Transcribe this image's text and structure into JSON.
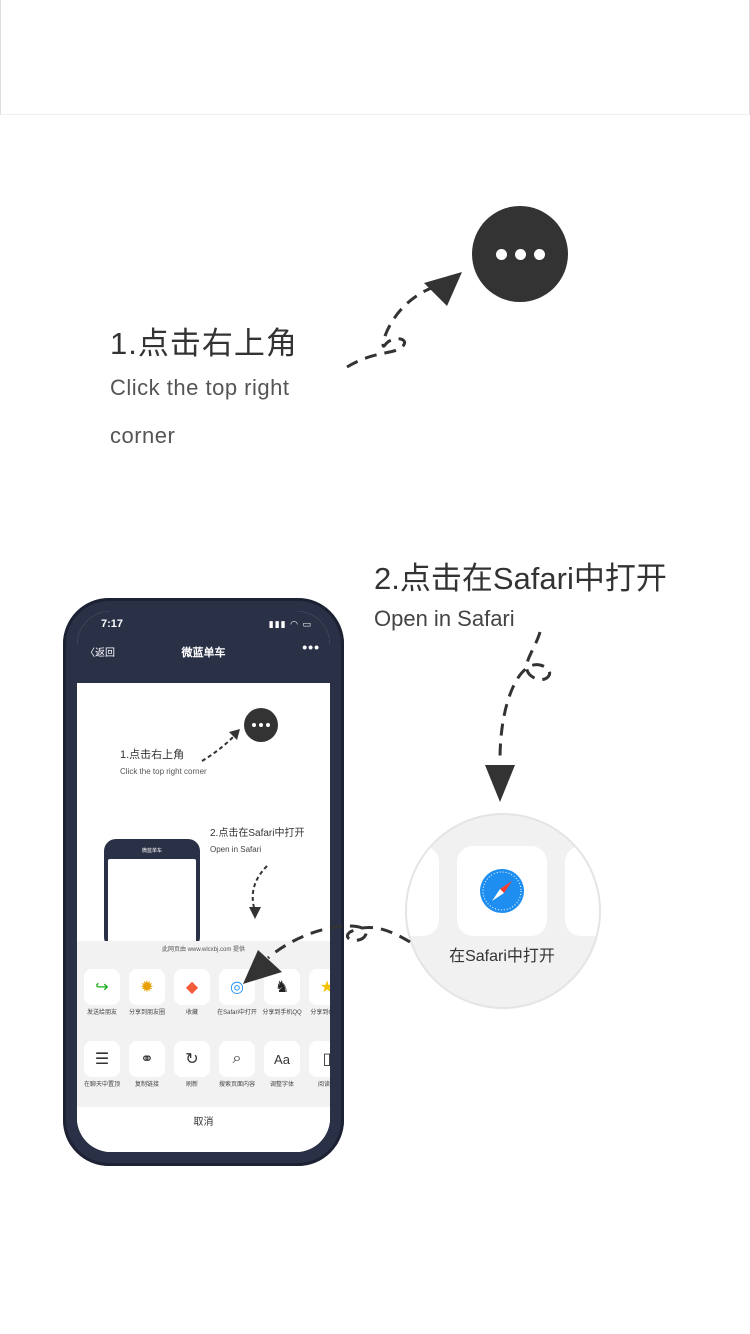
{
  "step1": {
    "title": "1.点击右上角",
    "subtitle": "Click the top right corner"
  },
  "step2": {
    "title": "2.点击在Safari中打开",
    "subtitle": "Open in Safari"
  },
  "phone": {
    "status_time": "7:17",
    "status_icons": "▮▮▮ ◠ ▭",
    "nav_back": "〈返回",
    "nav_title": "微蓝单车",
    "nav_more": "•••",
    "mini": {
      "step1_title": "1.点击右上角",
      "step1_sub": "Click the top right corner",
      "step2_title": "2.点击在Safari中打开",
      "step2_sub": "Open in Safari"
    },
    "share_sheet": {
      "provider": "此网页由 www.wlcxbj.com 提供",
      "row1": [
        {
          "icon": "share-forward-icon",
          "glyph": "↪",
          "label": "发送给朋友"
        },
        {
          "icon": "moments-icon",
          "glyph": "✹",
          "label": "分享到朋友圈"
        },
        {
          "icon": "favorite-cube-icon",
          "glyph": "◆",
          "label": "收藏"
        },
        {
          "icon": "safari-icon",
          "glyph": "◎",
          "label": "在Safari中打开"
        },
        {
          "icon": "qq-icon",
          "glyph": "♞",
          "label": "分享到手机QQ"
        },
        {
          "icon": "qzone-icon",
          "glyph": "★",
          "label": "分享到QQ空"
        }
      ],
      "row2": [
        {
          "icon": "pin-chat-icon",
          "glyph": "☰",
          "label": "在聊天中置顶"
        },
        {
          "icon": "link-icon",
          "glyph": "⚭",
          "label": "复制链接"
        },
        {
          "icon": "refresh-icon",
          "glyph": "↻",
          "label": "刷新"
        },
        {
          "icon": "search-icon",
          "glyph": "⌕",
          "label": "搜索页面内容"
        },
        {
          "icon": "font-size-icon",
          "glyph": "Aa",
          "label": "调整字体"
        },
        {
          "icon": "reader-icon",
          "glyph": "▯",
          "label": "阅读模"
        }
      ],
      "cancel": "取消"
    }
  },
  "magnifier": {
    "label": "在Safari中打开"
  },
  "colors": {
    "dark": "#333333",
    "phone_body": "#2a3146",
    "safari_blue": "#1e8ff0"
  }
}
